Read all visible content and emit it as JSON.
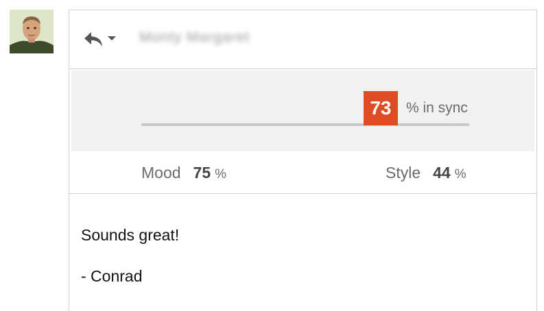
{
  "sender": {
    "name": "Monty Margaret",
    "avatar_icon": "avatar-photo"
  },
  "header": {
    "reply_icon": "reply-icon",
    "menu_icon": "chevron-down-icon"
  },
  "sync": {
    "score": "73",
    "score_fraction": 0.73,
    "suffix": "% in sync",
    "badge_color": "#de4c24"
  },
  "stats": {
    "mood": {
      "label": "Mood",
      "value": "75",
      "unit": "%"
    },
    "style": {
      "label": "Style",
      "value": "44",
      "unit": "%"
    }
  },
  "message": {
    "lines": [
      "Sounds great!",
      "- Conrad"
    ]
  }
}
